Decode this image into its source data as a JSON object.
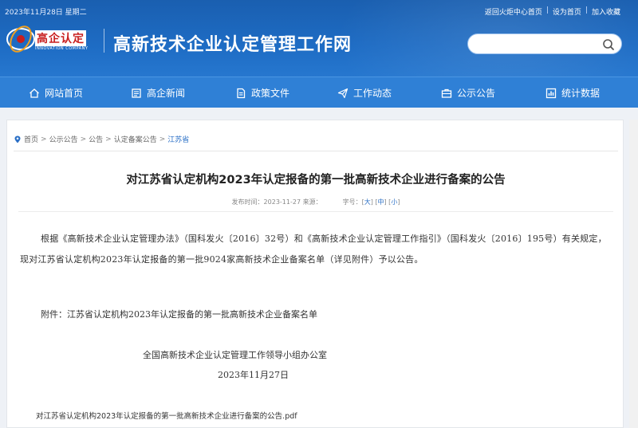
{
  "topbar": {
    "date": "2023年11月28日 星期二",
    "links": [
      "返回火炬中心首页",
      "设为首页",
      "加入收藏"
    ]
  },
  "logo": {
    "text": "高企认定",
    "subtext": "INNOVATION COMPANY"
  },
  "site_title": "高新技术企业认定管理工作网",
  "search": {
    "placeholder": ""
  },
  "nav": [
    {
      "label": "网站首页",
      "icon": "home-icon"
    },
    {
      "label": "高企新闻",
      "icon": "news-icon"
    },
    {
      "label": "政策文件",
      "icon": "document-icon"
    },
    {
      "label": "工作动态",
      "icon": "paper-plane-icon"
    },
    {
      "label": "公示公告",
      "icon": "briefcase-icon"
    },
    {
      "label": "统计数据",
      "icon": "bar-chart-icon"
    }
  ],
  "breadcrumb": {
    "items": [
      "首页",
      "公示公告",
      "公告",
      "认定备案公告"
    ],
    "current": "江苏省",
    "separator": ">"
  },
  "article": {
    "title": "对江苏省认定机构2023年认定报备的第一批高新技术企业进行备案的公告",
    "publish_label": "发布时间：2023-11-27 来源：",
    "font_size_label": "字号：",
    "font_sizes": [
      "大",
      "中",
      "小"
    ],
    "paragraph": "根据《高新技术企业认定管理办法》（国科发火〔2016〕32号）和《高新技术企业认定管理工作指引》（国科发火〔2016〕195号）有关规定，现对江苏省认定机构2023年认定报备的第一批9024家高新技术企业备案名单（详见附件）予以公告。",
    "attachment": "附件：江苏省认定机构2023年认定报备的第一批高新技术企业备案名单",
    "signature_org": "全国高新技术企业认定管理工作领导小组办公室",
    "signature_date": "2023年11月27日",
    "pdf_link": "对江苏省认定机构2023年认定报备的第一批高新技术企业进行备案的公告.pdf"
  },
  "colors": {
    "header_blue": "#1e6cc4",
    "nav_blue": "#2f80d6",
    "link_blue": "#2a6fc6",
    "logo_red": "#c81e1e"
  }
}
